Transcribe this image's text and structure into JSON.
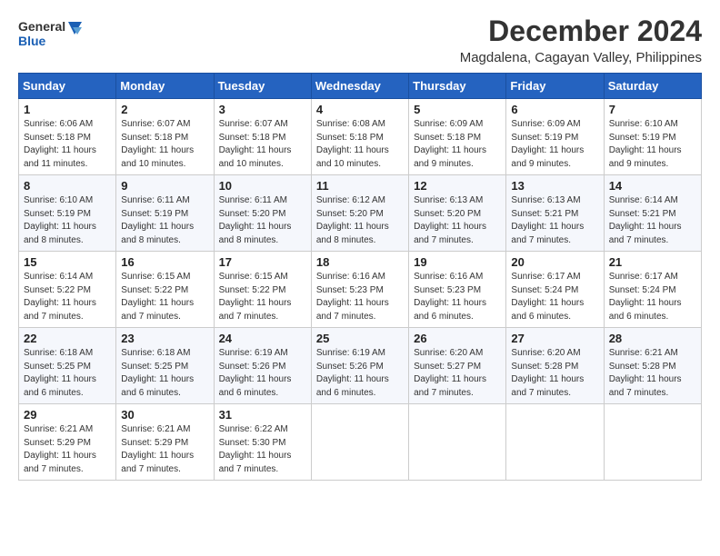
{
  "logo": {
    "general": "General",
    "blue": "Blue"
  },
  "title": "December 2024",
  "location": "Magdalena, Cagayan Valley, Philippines",
  "days_header": [
    "Sunday",
    "Monday",
    "Tuesday",
    "Wednesday",
    "Thursday",
    "Friday",
    "Saturday"
  ],
  "weeks": [
    [
      {
        "day": "1",
        "info": "Sunrise: 6:06 AM\nSunset: 5:18 PM\nDaylight: 11 hours\nand 11 minutes."
      },
      {
        "day": "2",
        "info": "Sunrise: 6:07 AM\nSunset: 5:18 PM\nDaylight: 11 hours\nand 10 minutes."
      },
      {
        "day": "3",
        "info": "Sunrise: 6:07 AM\nSunset: 5:18 PM\nDaylight: 11 hours\nand 10 minutes."
      },
      {
        "day": "4",
        "info": "Sunrise: 6:08 AM\nSunset: 5:18 PM\nDaylight: 11 hours\nand 10 minutes."
      },
      {
        "day": "5",
        "info": "Sunrise: 6:09 AM\nSunset: 5:18 PM\nDaylight: 11 hours\nand 9 minutes."
      },
      {
        "day": "6",
        "info": "Sunrise: 6:09 AM\nSunset: 5:19 PM\nDaylight: 11 hours\nand 9 minutes."
      },
      {
        "day": "7",
        "info": "Sunrise: 6:10 AM\nSunset: 5:19 PM\nDaylight: 11 hours\nand 9 minutes."
      }
    ],
    [
      {
        "day": "8",
        "info": "Sunrise: 6:10 AM\nSunset: 5:19 PM\nDaylight: 11 hours\nand 8 minutes."
      },
      {
        "day": "9",
        "info": "Sunrise: 6:11 AM\nSunset: 5:19 PM\nDaylight: 11 hours\nand 8 minutes."
      },
      {
        "day": "10",
        "info": "Sunrise: 6:11 AM\nSunset: 5:20 PM\nDaylight: 11 hours\nand 8 minutes."
      },
      {
        "day": "11",
        "info": "Sunrise: 6:12 AM\nSunset: 5:20 PM\nDaylight: 11 hours\nand 8 minutes."
      },
      {
        "day": "12",
        "info": "Sunrise: 6:13 AM\nSunset: 5:20 PM\nDaylight: 11 hours\nand 7 minutes."
      },
      {
        "day": "13",
        "info": "Sunrise: 6:13 AM\nSunset: 5:21 PM\nDaylight: 11 hours\nand 7 minutes."
      },
      {
        "day": "14",
        "info": "Sunrise: 6:14 AM\nSunset: 5:21 PM\nDaylight: 11 hours\nand 7 minutes."
      }
    ],
    [
      {
        "day": "15",
        "info": "Sunrise: 6:14 AM\nSunset: 5:22 PM\nDaylight: 11 hours\nand 7 minutes."
      },
      {
        "day": "16",
        "info": "Sunrise: 6:15 AM\nSunset: 5:22 PM\nDaylight: 11 hours\nand 7 minutes."
      },
      {
        "day": "17",
        "info": "Sunrise: 6:15 AM\nSunset: 5:22 PM\nDaylight: 11 hours\nand 7 minutes."
      },
      {
        "day": "18",
        "info": "Sunrise: 6:16 AM\nSunset: 5:23 PM\nDaylight: 11 hours\nand 7 minutes."
      },
      {
        "day": "19",
        "info": "Sunrise: 6:16 AM\nSunset: 5:23 PM\nDaylight: 11 hours\nand 6 minutes."
      },
      {
        "day": "20",
        "info": "Sunrise: 6:17 AM\nSunset: 5:24 PM\nDaylight: 11 hours\nand 6 minutes."
      },
      {
        "day": "21",
        "info": "Sunrise: 6:17 AM\nSunset: 5:24 PM\nDaylight: 11 hours\nand 6 minutes."
      }
    ],
    [
      {
        "day": "22",
        "info": "Sunrise: 6:18 AM\nSunset: 5:25 PM\nDaylight: 11 hours\nand 6 minutes."
      },
      {
        "day": "23",
        "info": "Sunrise: 6:18 AM\nSunset: 5:25 PM\nDaylight: 11 hours\nand 6 minutes."
      },
      {
        "day": "24",
        "info": "Sunrise: 6:19 AM\nSunset: 5:26 PM\nDaylight: 11 hours\nand 6 minutes."
      },
      {
        "day": "25",
        "info": "Sunrise: 6:19 AM\nSunset: 5:26 PM\nDaylight: 11 hours\nand 6 minutes."
      },
      {
        "day": "26",
        "info": "Sunrise: 6:20 AM\nSunset: 5:27 PM\nDaylight: 11 hours\nand 7 minutes."
      },
      {
        "day": "27",
        "info": "Sunrise: 6:20 AM\nSunset: 5:28 PM\nDaylight: 11 hours\nand 7 minutes."
      },
      {
        "day": "28",
        "info": "Sunrise: 6:21 AM\nSunset: 5:28 PM\nDaylight: 11 hours\nand 7 minutes."
      }
    ],
    [
      {
        "day": "29",
        "info": "Sunrise: 6:21 AM\nSunset: 5:29 PM\nDaylight: 11 hours\nand 7 minutes."
      },
      {
        "day": "30",
        "info": "Sunrise: 6:21 AM\nSunset: 5:29 PM\nDaylight: 11 hours\nand 7 minutes."
      },
      {
        "day": "31",
        "info": "Sunrise: 6:22 AM\nSunset: 5:30 PM\nDaylight: 11 hours\nand 7 minutes."
      },
      null,
      null,
      null,
      null
    ]
  ]
}
